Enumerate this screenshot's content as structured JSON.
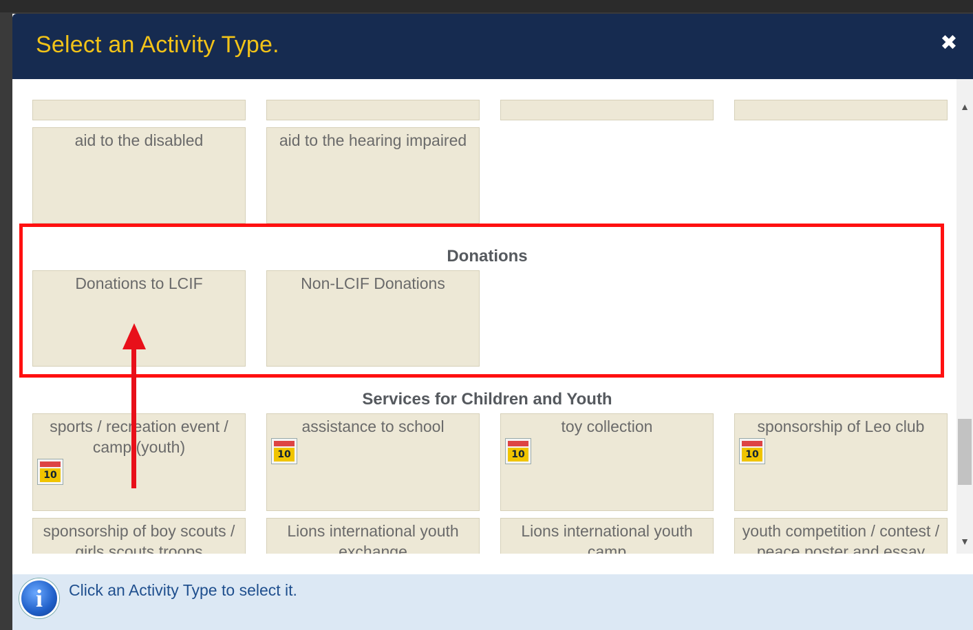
{
  "modal": {
    "title": "Select an Activity Type.",
    "close_icon": "close-x-icon"
  },
  "sections": {
    "donations_title": "Donations",
    "children_title": "Services for Children and Youth"
  },
  "tiles": {
    "aid_disabled": "aid to the disabled",
    "aid_hearing": "aid to the hearing impaired",
    "donations_lcif": "Donations to LCIF",
    "non_lcif": "Non-LCIF Donations",
    "sports": "sports / recreation event / camp (youth)",
    "assistance_school": "assistance to school",
    "toy_collection": "toy collection",
    "leo_club": "sponsorship of Leo club",
    "boy_scouts": "sponsorship of boy scouts / girls scouts troops",
    "youth_exchange": "Lions international youth exchange",
    "youth_camp": "Lions international youth camp",
    "youth_competition": "youth competition / contest / peace poster and essay"
  },
  "badge": {
    "label": "10",
    "icon": "simple-service-badge-icon"
  },
  "footer": {
    "info_icon": "info-icon",
    "info_glyph": "i",
    "message": "Click an Activity Type to select it."
  },
  "scrollbar": {
    "up_glyph": "▲",
    "down_glyph": "▼"
  },
  "annotation": {
    "highlight_color": "#ff1010"
  }
}
